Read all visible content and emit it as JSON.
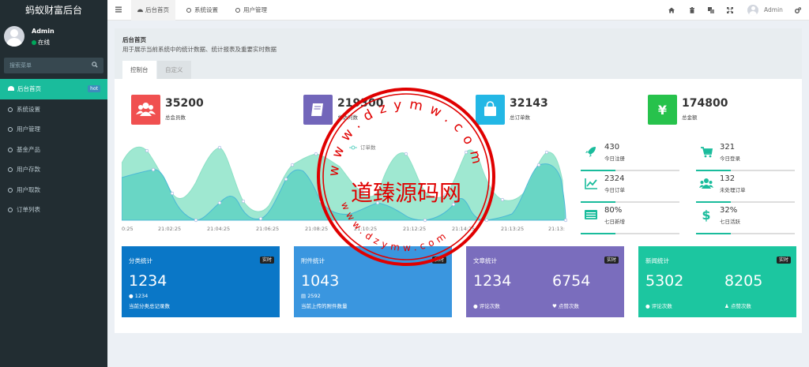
{
  "sidebar": {
    "brand": "蚂蚁财富后台",
    "user": {
      "name": "Admin",
      "status": "在线"
    },
    "search_placeholder": "搜索菜单",
    "items": [
      {
        "label": "后台首页",
        "badge": "hot"
      },
      {
        "label": "系统设置"
      },
      {
        "label": "用户管理"
      },
      {
        "label": "基金产品"
      },
      {
        "label": "用户存款"
      },
      {
        "label": "用户取款"
      },
      {
        "label": "订单列表"
      }
    ]
  },
  "topbar": {
    "tabs": [
      {
        "label": "后台首页"
      },
      {
        "label": "系统设置"
      },
      {
        "label": "用户管理"
      }
    ],
    "user": "Admin",
    "icons": [
      "home-icon",
      "trash-icon",
      "translate-icon",
      "fullscreen-icon",
      "settings-icon"
    ]
  },
  "header": {
    "title": "后台首页",
    "subtitle": "用于展示当前系统中的统计数据、统计报表及重要实时数据",
    "tabs": [
      {
        "label": "控制台"
      },
      {
        "label": "自定义"
      }
    ]
  },
  "stats": [
    {
      "value": "35200",
      "label": "总会员数",
      "color": "#f05050",
      "icon": "users-icon"
    },
    {
      "value": "219300",
      "label": "总访问数",
      "color": "#7266ba",
      "icon": "book-icon"
    },
    {
      "value": "32143",
      "label": "总订单数",
      "color": "#23b7e5",
      "icon": "shopping-bag-icon"
    },
    {
      "value": "174800",
      "label": "总金额",
      "color": "#27c24c",
      "icon": "yen-icon"
    }
  ],
  "chart_data": {
    "type": "area",
    "series": [
      {
        "name": "订单数"
      }
    ],
    "x_ticks": [
      "0:25",
      "21:02:25",
      "21:04:25",
      "21:06:25",
      "21:08:25",
      "21:10:25",
      "21:12:25",
      "21:14:25",
      "21:13:25",
      "21:13:"
    ]
  },
  "mini_stats": [
    {
      "value": "430",
      "label": "今日注册",
      "icon": "rocket-icon"
    },
    {
      "value": "321",
      "label": "今日登录",
      "icon": "cart-icon"
    },
    {
      "value": "2324",
      "label": "今日订单",
      "icon": "chart-line-icon"
    },
    {
      "value": "132",
      "label": "未处理订单",
      "icon": "users-icon"
    },
    {
      "value": "80%",
      "label": "七日新增",
      "icon": "list-icon"
    },
    {
      "value": "32%",
      "label": "七日活跃",
      "icon": "dollar-icon"
    }
  ],
  "cards": [
    {
      "title": "分类统计",
      "badge": "实时",
      "value": "1234",
      "small": "1234",
      "desc": "当前分类总记录数",
      "color": "#0a77c7"
    },
    {
      "title": "附件统计",
      "badge": "实时",
      "value": "1043",
      "small": "2592",
      "desc": "当前上传的附件数量",
      "color": "#3a96df"
    },
    {
      "title": "文章统计",
      "badge": "实时",
      "v1": "1234",
      "l1": "评论次数",
      "v2": "6754",
      "l2": "点赞次数",
      "color": "#7a6dbd"
    },
    {
      "title": "新闻统计",
      "badge": "实时",
      "v1": "5302",
      "l1": "评论次数",
      "v2": "8205",
      "l2": "点赞次数",
      "color": "#1cc6a0"
    }
  ],
  "watermark": {
    "text": "道臻源码网",
    "url": "www.dzymw.com"
  }
}
